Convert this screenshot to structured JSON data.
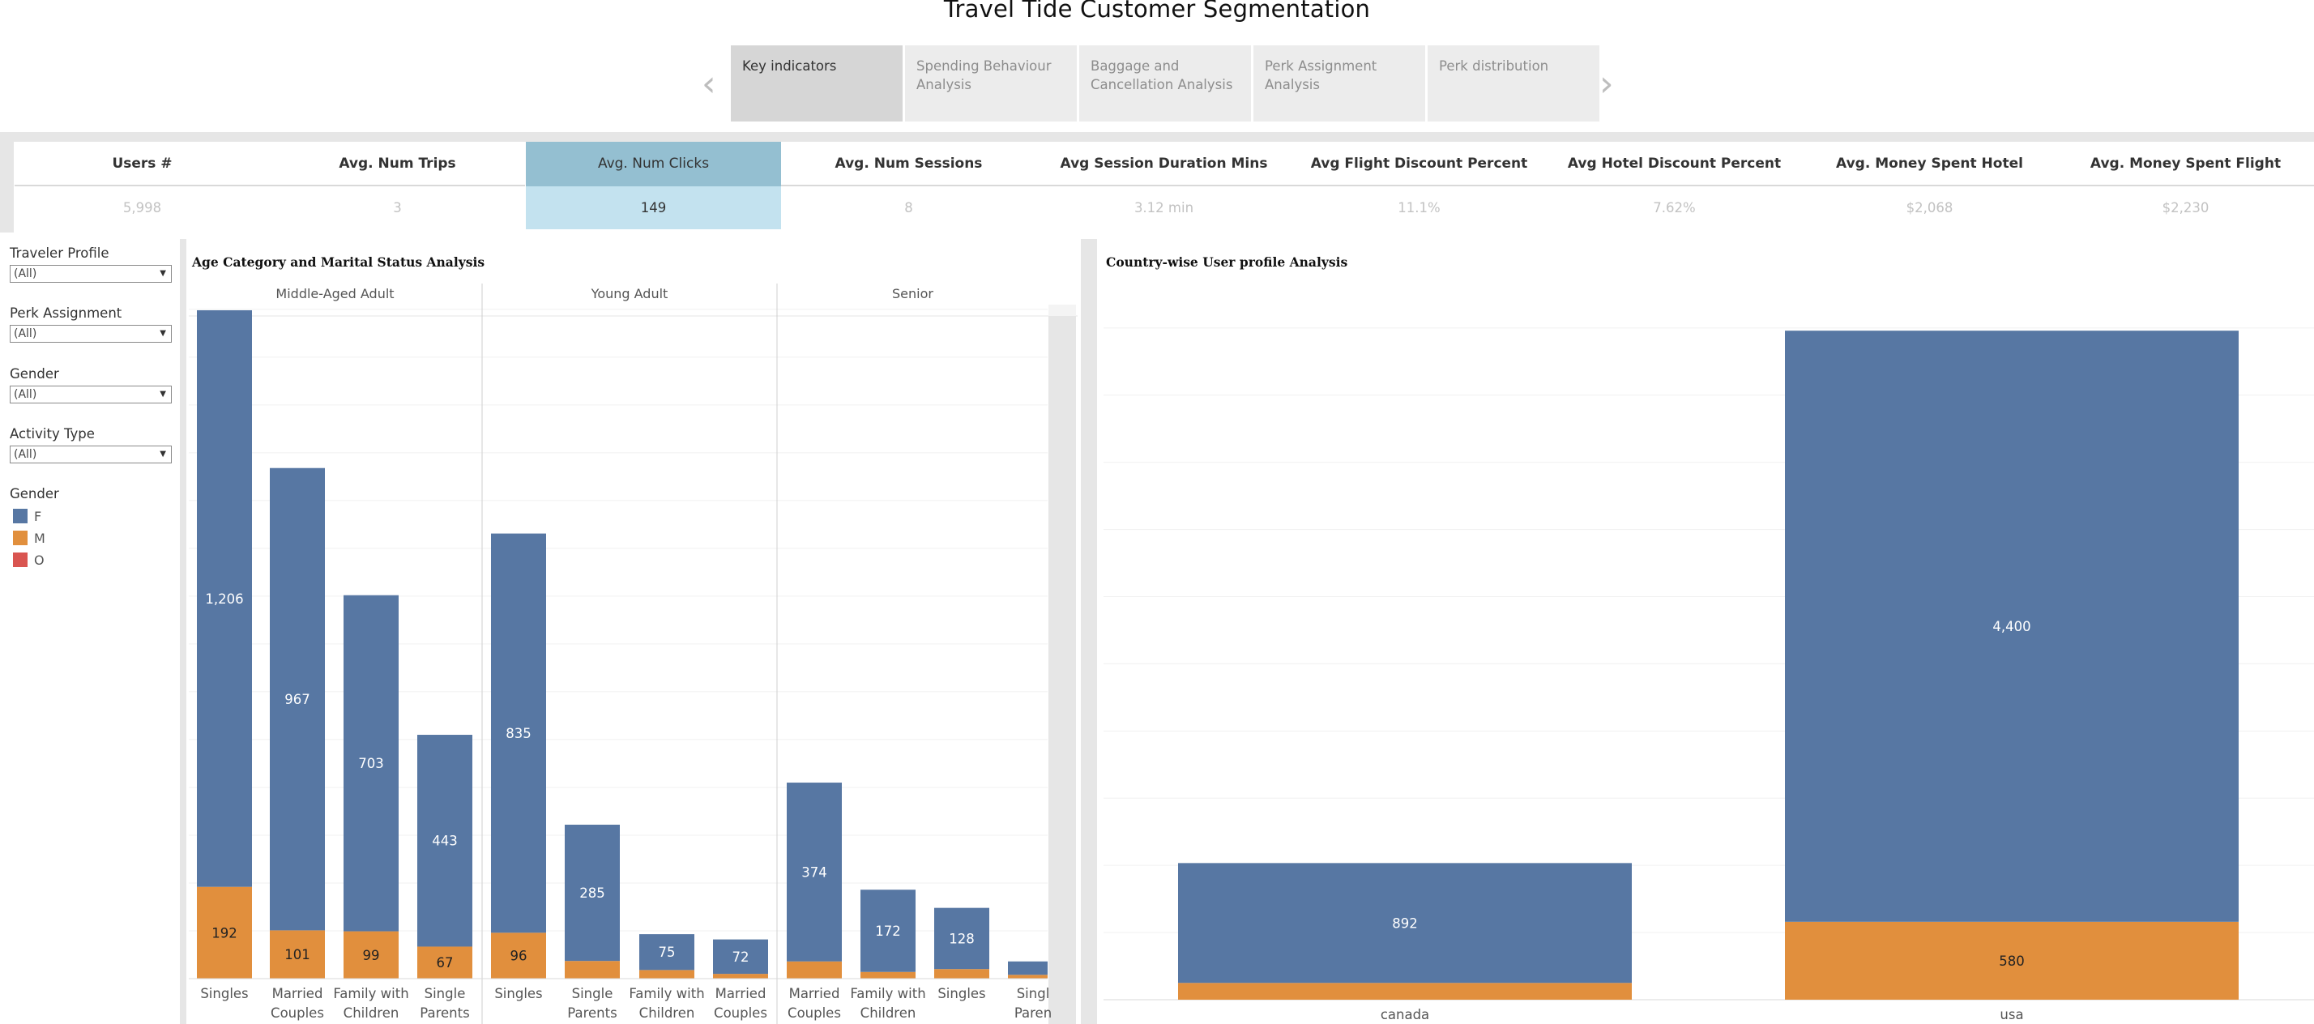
{
  "title": "Travel Tide Customer Segmentation",
  "story": {
    "tabs": [
      {
        "label": "Key indicators",
        "active": true
      },
      {
        "label": "Spending Behaviour Analysis"
      },
      {
        "label": "Baggage and Cancellation Analysis"
      },
      {
        "label": "Perk Assignment Analysis"
      },
      {
        "label": "Perk distribution"
      }
    ],
    "prev_icon": "chevron-left",
    "next_icon": "chevron-right"
  },
  "kpis": [
    {
      "label": "Users #",
      "value": "5,998"
    },
    {
      "label": "Avg. Num Trips",
      "value": "3"
    },
    {
      "label": "Avg. Num Clicks",
      "value": "149",
      "highlighted": true
    },
    {
      "label": "Avg. Num Sessions",
      "value": "8"
    },
    {
      "label": "Avg Session Duration Mins",
      "value": "3.12 min"
    },
    {
      "label": "Avg Flight Discount Percent",
      "value": "11.1%"
    },
    {
      "label": "Avg Hotel Discount Percent",
      "value": "7.62%"
    },
    {
      "label": "Avg. Money Spent Hotel",
      "value": "$2,068"
    },
    {
      "label": "Avg. Money Spent Flight",
      "value": "$2,230"
    }
  ],
  "filters": [
    {
      "label": "Traveler Profile",
      "value": "(All)"
    },
    {
      "label": "Perk Assignment",
      "value": "(All)"
    },
    {
      "label": "Gender",
      "value": "(All)"
    },
    {
      "label": "Activity Type",
      "value": "(All)"
    }
  ],
  "legend": {
    "title": "Gender",
    "items": [
      {
        "label": "F",
        "color": "#5777a3"
      },
      {
        "label": "M",
        "color": "#e18f3d"
      },
      {
        "label": "O",
        "color": "#d95550"
      }
    ]
  },
  "colors": {
    "F": "#5777a3",
    "M": "#e18f3d",
    "O": "#d95550",
    "kpi_highlight_header": "#94bfd1",
    "kpi_highlight_value": "#c3e2ef"
  },
  "chart_data": [
    {
      "type": "bar",
      "stacked": true,
      "title": "Age Category and Marital Status Analysis",
      "groups": [
        "Middle-Aged Adult",
        "Young Adult",
        "Senior"
      ],
      "categories": [
        {
          "group": "Middle-Aged Adult",
          "label": [
            "Singles"
          ],
          "F": 1206,
          "M": 192
        },
        {
          "group": "Middle-Aged Adult",
          "label": [
            "Married",
            "Couples"
          ],
          "F": 967,
          "M": 101
        },
        {
          "group": "Middle-Aged Adult",
          "label": [
            "Family with",
            "Children"
          ],
          "F": 703,
          "M": 99
        },
        {
          "group": "Middle-Aged Adult",
          "label": [
            "Single",
            "Parents"
          ],
          "F": 443,
          "M": 67
        },
        {
          "group": "Young Adult",
          "label": [
            "Singles"
          ],
          "F": 835,
          "M": 96
        },
        {
          "group": "Young Adult",
          "label": [
            "Single",
            "Parents"
          ],
          "F": 285,
          "M": 37
        },
        {
          "group": "Young Adult",
          "label": [
            "Family with",
            "Children"
          ],
          "F": 75,
          "M": 18
        },
        {
          "group": "Young Adult",
          "label": [
            "Married",
            "Couples"
          ],
          "F": 72,
          "M": 10
        },
        {
          "group": "Senior",
          "label": [
            "Married",
            "Couples"
          ],
          "F": 374,
          "M": 36
        },
        {
          "group": "Senior",
          "label": [
            "Family with",
            "Children"
          ],
          "F": 172,
          "M": 14
        },
        {
          "group": "Senior",
          "label": [
            "Singles"
          ],
          "F": 128,
          "M": 20
        },
        {
          "group": "Senior",
          "label": [
            "Singl",
            "Paren"
          ],
          "F": 28,
          "M": 8
        }
      ],
      "series": [
        {
          "name": "F"
        },
        {
          "name": "M"
        }
      ],
      "ylim": [
        0,
        1420
      ],
      "grid": true
    },
    {
      "type": "bar",
      "stacked": true,
      "title": "Country-wise User profile Analysis",
      "categories": [
        "canada",
        "usa"
      ],
      "series": [
        {
          "name": "F",
          "values": [
            892,
            4400
          ]
        },
        {
          "name": "M",
          "values": [
            125,
            580
          ]
        }
      ],
      "ylim": [
        0,
        5150
      ],
      "grid": true
    }
  ]
}
